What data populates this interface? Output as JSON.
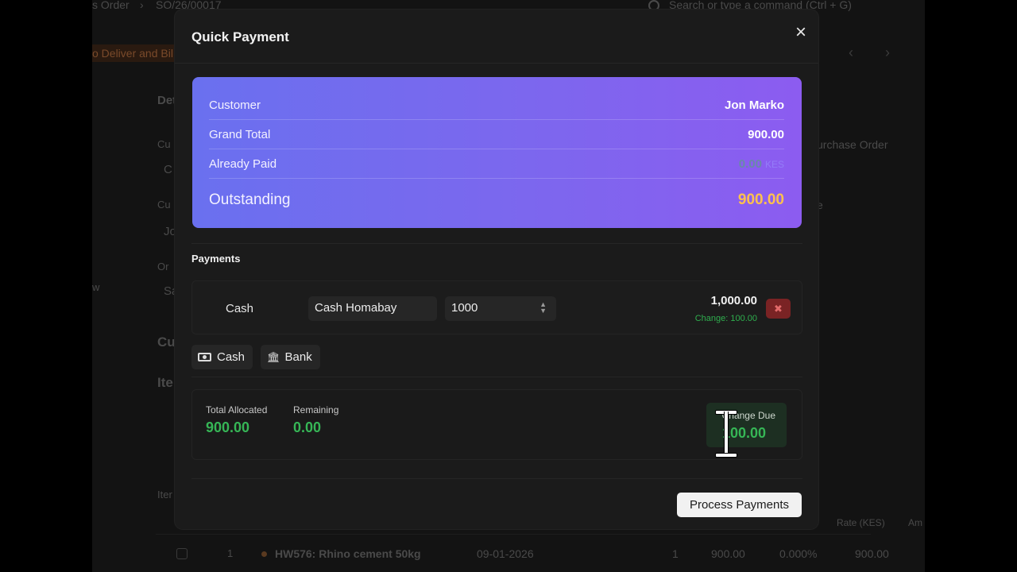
{
  "background": {
    "breadcrumb_doctype": "s Order",
    "breadcrumb_sep": "›",
    "breadcrumb_doc": "SO/26/00017",
    "search_placeholder": "Search or type a command (Ctrl + G)",
    "status_badge": "o Deliver and Bil",
    "section_details": "Det",
    "field_cu1": "Cu",
    "field_c": "C",
    "field_cu2": "Cu",
    "field_jo": "Jo",
    "field_or": "Or",
    "field_sa": "Sa",
    "label_w": "w",
    "section_cu": "Cu",
    "section_ite": "Ite",
    "label_purchase_order": "urchase Order",
    "label_e": "e",
    "items_label": "Iter",
    "col_rate": "Rate (KES)",
    "col_am": "Am",
    "row": {
      "idx": "1",
      "item": "HW576: Rhino cement 50kg",
      "date": "09-01-2026",
      "qty": "1",
      "rate": "900.00",
      "discount": "0.000%",
      "amount": "900.00"
    }
  },
  "modal": {
    "title": "Quick Payment",
    "close": "×",
    "summary": {
      "customer_label": "Customer",
      "customer_value": "Jon Marko",
      "grand_total_label": "Grand Total",
      "grand_total_value": "900.00",
      "already_paid_label": "Already Paid",
      "already_paid_value": "0.00",
      "already_paid_unit": "KES",
      "outstanding_label": "Outstanding",
      "outstanding_value": "900.00"
    },
    "payments_title": "Payments",
    "payment_row": {
      "mode": "Cash",
      "account": "Cash Homabay",
      "amount_input": "1000",
      "amount_display": "1,000.00",
      "change": "Change: 100.00",
      "remove": "✖"
    },
    "mode_buttons": {
      "cash": "Cash",
      "bank": "Bank"
    },
    "totals": {
      "allocated_label": "Total Allocated",
      "allocated_value": "900.00",
      "remaining_label": "Remaining",
      "remaining_value": "0.00",
      "change_due_label": "Change Due",
      "change_due_value": "100.00"
    },
    "process_button": "Process Payments"
  },
  "colors": {
    "gradient_start": "#6a70ef",
    "gradient_end": "#8c5cf0",
    "outstanding": "#ffc14d",
    "positive": "#36b656",
    "danger": "#7a2324"
  }
}
